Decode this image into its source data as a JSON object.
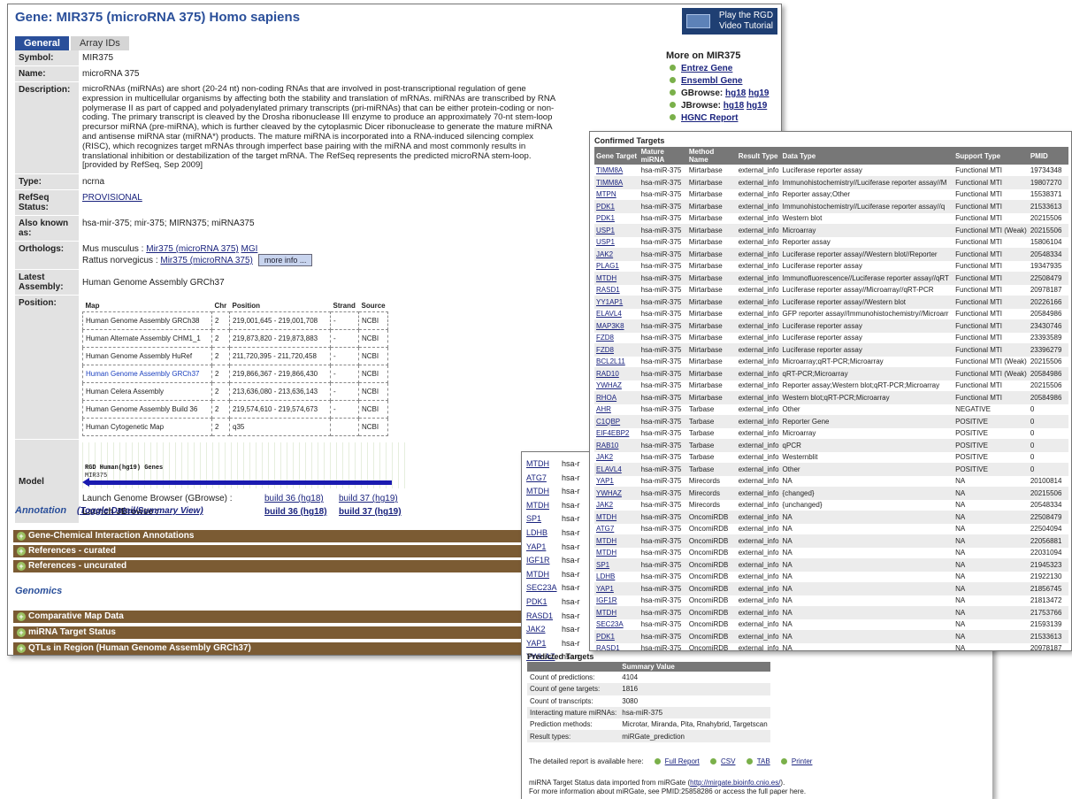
{
  "main": {
    "title": "Gene: MIR375 (microRNA 375) Homo sapiens",
    "video_tutorial": "Play the RGD Video Tutorial",
    "tabs": [
      "General",
      "Array IDs"
    ],
    "labels": {
      "symbol": "Symbol:",
      "name": "Name:",
      "description": "Description:",
      "type": "Type:",
      "refseq": "RefSeq Status:",
      "aka": "Also known as:",
      "orthologs": "Orthologs:",
      "assembly": "Latest Assembly:",
      "position": "Position:",
      "model": "Model"
    },
    "symbol": "MIR375",
    "name": "microRNA 375",
    "description": "microRNAs (miRNAs) are short (20-24 nt) non-coding RNAs that are involved in post-transcriptional regulation of gene expression in multicellular organisms by affecting both the stability and translation of mRNAs. miRNAs are transcribed by RNA polymerase II as part of capped and polyadenylated primary transcripts (pri-miRNAs) that can be either protein-coding or non-coding. The primary transcript is cleaved by the Drosha ribonuclease III enzyme to produce an approximately 70-nt stem-loop precursor miRNA (pre-miRNA), which is further cleaved by the cytoplasmic Dicer ribonuclease to generate the mature miRNA and antisense miRNA star (miRNA*) products. The mature miRNA is incorporated into a RNA-induced silencing complex (RISC), which recognizes target mRNAs through imperfect base pairing with the miRNA and most commonly results in translational inhibition or destabilization of the target mRNA. The RefSeq represents the predicted microRNA stem-loop. [provided by RefSeq, Sep 2009]",
    "type": "ncrna",
    "refseq_status": "PROVISIONAL",
    "aka": "hsa-mir-375; mir-375; MIRN375; miRNA375",
    "ortholog_mouse_prefix": "Mus musculus : ",
    "ortholog_mouse_link": "Mir375 (microRNA 375)",
    "ortholog_mouse_mgi": "MGI",
    "ortholog_rat_prefix": "Rattus norvegicus : ",
    "ortholog_rat_link": "Mir375 (microRNA 375)",
    "more_info_button": "more info ...",
    "latest_assembly": "Human Genome Assembly GRCh37",
    "position_headers": [
      "Map",
      "Chr",
      "Position",
      "Strand",
      "Source"
    ],
    "positions": [
      {
        "map": "Human Genome Assembly GRCh38",
        "chr": "2",
        "pos": "219,001,645 - 219,001,708",
        "strand": "-",
        "source": "NCBI"
      },
      {
        "map": "Human Alternate Assembly CHM1_1",
        "chr": "2",
        "pos": "219,873,820 - 219,873,883",
        "strand": "-",
        "source": "NCBI"
      },
      {
        "map": "Human Genome Assembly HuRef",
        "chr": "2",
        "pos": "211,720,395 - 211,720,458",
        "strand": "-",
        "source": "NCBI"
      },
      {
        "map": "Human Genome Assembly GRCh37",
        "chr": "2",
        "pos": "219,866,367 - 219,866,430",
        "strand": "-",
        "source": "NCBI"
      },
      {
        "map": "Human Celera Assembly",
        "chr": "2",
        "pos": "213,636,080 - 213,636,143",
        "strand": "-",
        "source": "NCBI"
      },
      {
        "map": "Human Genome Assembly Build 36",
        "chr": "2",
        "pos": "219,574,610 - 219,574,673",
        "strand": "-",
        "source": "NCBI"
      },
      {
        "map": "Human Cytogenetic Map",
        "chr": "2",
        "pos": "q35",
        "strand": "",
        "source": "NCBI"
      }
    ],
    "model_track": "RGD Human(hg19) Genes",
    "model_gene": "MIR375",
    "launch_gbrowse_label": "Launch Genome Browser (GBrowse) :",
    "launch_jbrowse_label": "Launch JBrowse :",
    "launch_link36": "build 36 (hg18)",
    "launch_link37": "build 37 (hg19)",
    "annotation_heading": "Annotation",
    "toggle_link": "(Toggle Detail/Summary View)",
    "annotation_bars": [
      "Gene-Chemical Interaction Annotations",
      "References - curated",
      "References - uncurated"
    ],
    "genomics_heading": "Genomics",
    "genomics_bars": [
      "Comparative Map Data",
      "miRNA Target Status",
      "QTLs in Region (Human Genome Assembly GRCh37)"
    ],
    "more_heading": "More on MIR375",
    "more_links": {
      "entrez": "Entrez Gene",
      "ensembl": "Ensembl Gene",
      "gbrowse": "GBrowse:",
      "jbrowse": "JBrowse:",
      "hg18": "hg18",
      "hg19": "hg19",
      "hgnc": "HGNC Report"
    }
  },
  "confirmed": {
    "title": "Confirmed Targets",
    "headers": [
      "Gene Target",
      "Mature miRNA",
      "Method Name",
      "Result Type",
      "Data Type",
      "Support Type",
      "PMID"
    ],
    "rows": [
      [
        "TIMM8A",
        "hsa-miR-375",
        "Mirtarbase",
        "external_info",
        "Luciferase reporter assay",
        "Functional MTI",
        "19734348"
      ],
      [
        "TIMM8A",
        "hsa-miR-375",
        "Mirtarbase",
        "external_info",
        "Immunohistochemistry//Luciferase reporter assay//M",
        "Functional MTI",
        "19807270"
      ],
      [
        "MTPN",
        "hsa-miR-375",
        "Mirtarbase",
        "external_info",
        "Reporter assay;Other",
        "Functional MTI",
        "15538371"
      ],
      [
        "PDK1",
        "hsa-miR-375",
        "Mirtarbase",
        "external_info",
        "Immunohistochemistry//Luciferase reporter assay//q",
        "Functional MTI",
        "21533613"
      ],
      [
        "PDK1",
        "hsa-miR-375",
        "Mirtarbase",
        "external_info",
        "Western blot",
        "Functional MTI",
        "20215506"
      ],
      [
        "USP1",
        "hsa-miR-375",
        "Mirtarbase",
        "external_info",
        "Microarray",
        "Functional MTI (Weak)",
        "20215506"
      ],
      [
        "USP1",
        "hsa-miR-375",
        "Mirtarbase",
        "external_info",
        "Reporter assay",
        "Functional MTI",
        "15806104"
      ],
      [
        "JAK2",
        "hsa-miR-375",
        "Mirtarbase",
        "external_info",
        "Luciferase reporter assay//Western blot//Reporter",
        "Functional MTI",
        "20548334"
      ],
      [
        "PLAG1",
        "hsa-miR-375",
        "Mirtarbase",
        "external_info",
        "Luciferase reporter assay",
        "Functional MTI",
        "19347935"
      ],
      [
        "MTDH",
        "hsa-miR-375",
        "Mirtarbase",
        "external_info",
        "Immunofluorescence//Luciferase reporter assay//qRT",
        "Functional MTI",
        "22508479"
      ],
      [
        "RASD1",
        "hsa-miR-375",
        "Mirtarbase",
        "external_info",
        "Luciferase reporter assay//Microarray//qRT-PCR",
        "Functional MTI",
        "20978187"
      ],
      [
        "YY1AP1",
        "hsa-miR-375",
        "Mirtarbase",
        "external_info",
        "Luciferase reporter assay//Western blot",
        "Functional MTI",
        "20226166"
      ],
      [
        "ELAVL4",
        "hsa-miR-375",
        "Mirtarbase",
        "external_info",
        "GFP reporter assay//Immunohistochemistry//Microarr",
        "Functional MTI",
        "20584986"
      ],
      [
        "MAP3K8",
        "hsa-miR-375",
        "Mirtarbase",
        "external_info",
        "Luciferase reporter assay",
        "Functional MTI",
        "23430746"
      ],
      [
        "FZD8",
        "hsa-miR-375",
        "Mirtarbase",
        "external_info",
        "Luciferase reporter assay",
        "Functional MTI",
        "23393589"
      ],
      [
        "FZD8",
        "hsa-miR-375",
        "Mirtarbase",
        "external_info",
        "Luciferase reporter assay",
        "Functional MTI",
        "23396279"
      ],
      [
        "BCL2L11",
        "hsa-miR-375",
        "Mirtarbase",
        "external_info",
        "Microarray;qRT-PCR;Microarray",
        "Functional MTI (Weak)",
        "20215506"
      ],
      [
        "RAD10",
        "hsa-miR-375",
        "Mirtarbase",
        "external_info",
        "qRT-PCR;Microarray",
        "Functional MTI (Weak)",
        "20584986"
      ],
      [
        "YWHAZ",
        "hsa-miR-375",
        "Mirtarbase",
        "external_info",
        "Reporter assay;Western blot;qRT-PCR;Microarray",
        "Functional MTI",
        "20215506"
      ],
      [
        "RHOA",
        "hsa-miR-375",
        "Mirtarbase",
        "external_info",
        "Western blot;qRT-PCR;Microarray",
        "Functional MTI",
        "20584986"
      ],
      [
        "AHR",
        "hsa-miR-375",
        "Tarbase",
        "external_info",
        "Other",
        "NEGATIVE",
        "0"
      ],
      [
        "C1QBP",
        "hsa-miR-375",
        "Tarbase",
        "external_info",
        "Reporter Gene",
        "POSITIVE",
        "0"
      ],
      [
        "EIF4EBP2",
        "hsa-miR-375",
        "Tarbase",
        "external_info",
        "Microarray",
        "POSITIVE",
        "0"
      ],
      [
        "RAB10",
        "hsa-miR-375",
        "Tarbase",
        "external_info",
        "qPCR",
        "POSITIVE",
        "0"
      ],
      [
        "JAK2",
        "hsa-miR-375",
        "Tarbase",
        "external_info",
        "Westernblit",
        "POSITIVE",
        "0"
      ],
      [
        "ELAVL4",
        "hsa-miR-375",
        "Tarbase",
        "external_info",
        "Other",
        "POSITIVE",
        "0"
      ],
      [
        "YAP1",
        "hsa-miR-375",
        "Mirecords",
        "external_info",
        "NA",
        "NA",
        "20100814"
      ],
      [
        "YWHAZ",
        "hsa-miR-375",
        "Mirecords",
        "external_info",
        "{changed}",
        "NA",
        "20215506"
      ],
      [
        "JAK2",
        "hsa-miR-375",
        "Mirecords",
        "external_info",
        "{unchanged}",
        "NA",
        "20548334"
      ],
      [
        "MTDH",
        "hsa-miR-375",
        "OncomiRDB",
        "external_info",
        "NA",
        "NA",
        "22508479"
      ],
      [
        "ATG7",
        "hsa-miR-375",
        "OncomiRDB",
        "external_info",
        "NA",
        "NA",
        "22504094"
      ],
      [
        "MTDH",
        "hsa-miR-375",
        "OncomiRDB",
        "external_info",
        "NA",
        "NA",
        "22056881"
      ],
      [
        "MTDH",
        "hsa-miR-375",
        "OncomiRDB",
        "external_info",
        "NA",
        "NA",
        "22031094"
      ],
      [
        "SP1",
        "hsa-miR-375",
        "OncomiRDB",
        "external_info",
        "NA",
        "NA",
        "21945323"
      ],
      [
        "LDHB",
        "hsa-miR-375",
        "OncomiRDB",
        "external_info",
        "NA",
        "NA",
        "21922130"
      ],
      [
        "YAP1",
        "hsa-miR-375",
        "OncomiRDB",
        "external_info",
        "NA",
        "NA",
        "21856745"
      ],
      [
        "IGF1R",
        "hsa-miR-375",
        "OncomiRDB",
        "external_info",
        "NA",
        "NA",
        "21813472"
      ],
      [
        "MTDH",
        "hsa-miR-375",
        "OncomiRDB",
        "external_info",
        "NA",
        "NA",
        "21753766"
      ],
      [
        "SEC23A",
        "hsa-miR-375",
        "OncomiRDB",
        "external_info",
        "NA",
        "NA",
        "21593139"
      ],
      [
        "PDK1",
        "hsa-miR-375",
        "OncomiRDB",
        "external_info",
        "NA",
        "NA",
        "21533613"
      ],
      [
        "RASD1",
        "hsa-miR-375",
        "OncomiRDB",
        "external_info",
        "NA",
        "NA",
        "20978187"
      ]
    ]
  },
  "partial": {
    "genes": [
      "MTDH",
      "ATG7",
      "MTDH",
      "MTDH",
      "SP1",
      "LDHB",
      "YAP1",
      "IGF1R",
      "MTDH",
      "SEC23A",
      "PDK1",
      "RASD1",
      "JAK2",
      "YAP1",
      "YWHAZ"
    ],
    "mirna_fragment": "hsa-r"
  },
  "predicted": {
    "title": "Predicted Targets",
    "headers": [
      "",
      "Summary Value"
    ],
    "rows": [
      [
        "Count of predictions:",
        "4104"
      ],
      [
        "Count of gene targets:",
        "1816"
      ],
      [
        "Count of transcripts:",
        "3080"
      ],
      [
        "Interacting mature miRNAs:",
        "hsa-miR-375"
      ],
      [
        "Prediction methods:",
        "Microtar, Miranda, Pita, Rnahybrid, Targetscan"
      ],
      [
        "Result types:",
        "miRGate_prediction"
      ]
    ],
    "detailed_label": "The detailed report is available here:",
    "download_links": [
      "Full Report",
      "CSV",
      "TAB",
      "Printer"
    ],
    "footer_line1_prefix": "miRNA Target Status data imported from miRGate (",
    "footer_url": "http://mirgate.bioinfo.cnio.es/",
    "footer_line1_suffix": ").",
    "footer_line2": "For more information about miRGate, see PMID:25858286 or access the full paper here."
  }
}
